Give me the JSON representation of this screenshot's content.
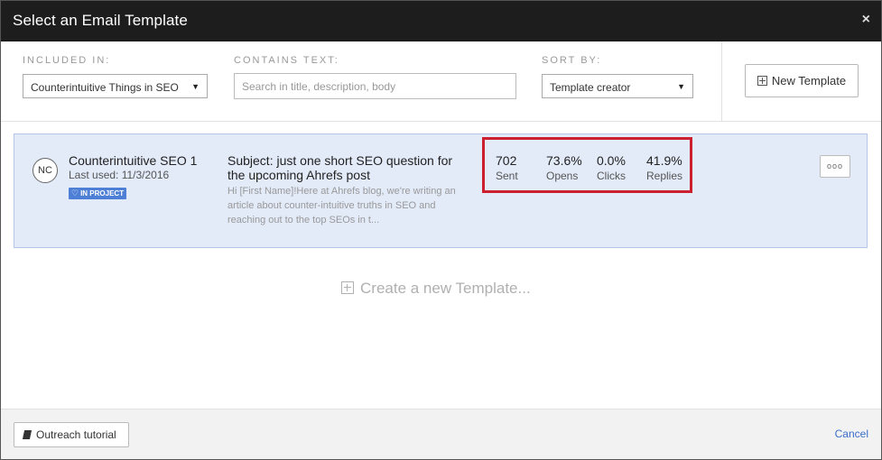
{
  "dialog": {
    "title": "Select an Email Template",
    "close_label": "×"
  },
  "filters": {
    "included_in": {
      "label": "INCLUDED IN:",
      "value": "Counterintuitive Things in SEO"
    },
    "contains_text": {
      "label": "CONTAINS TEXT:",
      "placeholder": "Search in title, description, body"
    },
    "sort_by": {
      "label": "SORT BY:",
      "value": "Template creator"
    },
    "new_template_label": "New Template"
  },
  "template": {
    "initials": "NC",
    "name": "Counterintuitive SEO 1",
    "last_used": "Last used: 11/3/2016",
    "badge": "IN PROJECT",
    "subject": "Subject: just one short SEO question for the upcoming Ahrefs post",
    "preview": "Hi [First Name]!Here at Ahrefs blog, we're writing an article about counter-intuitive truths in SEO and reaching out to the top SEOs in t...",
    "stats": [
      {
        "value": "702",
        "label": "Sent"
      },
      {
        "value": "73.6%",
        "label": "Opens"
      },
      {
        "value": "0.0%",
        "label": "Clicks"
      },
      {
        "value": "41.9%",
        "label": "Replies"
      }
    ],
    "more_label": "ooo"
  },
  "create_label": "Create a new Template...",
  "footer": {
    "tutorial_label": "Outreach tutorial",
    "cancel_label": "Cancel"
  },
  "colors": {
    "titlebar": "#1d1d1d",
    "card_bg": "#e3eaf8",
    "badge": "#4e7fd6",
    "highlight": "#cc1f2f",
    "link": "#3a6fc9"
  }
}
